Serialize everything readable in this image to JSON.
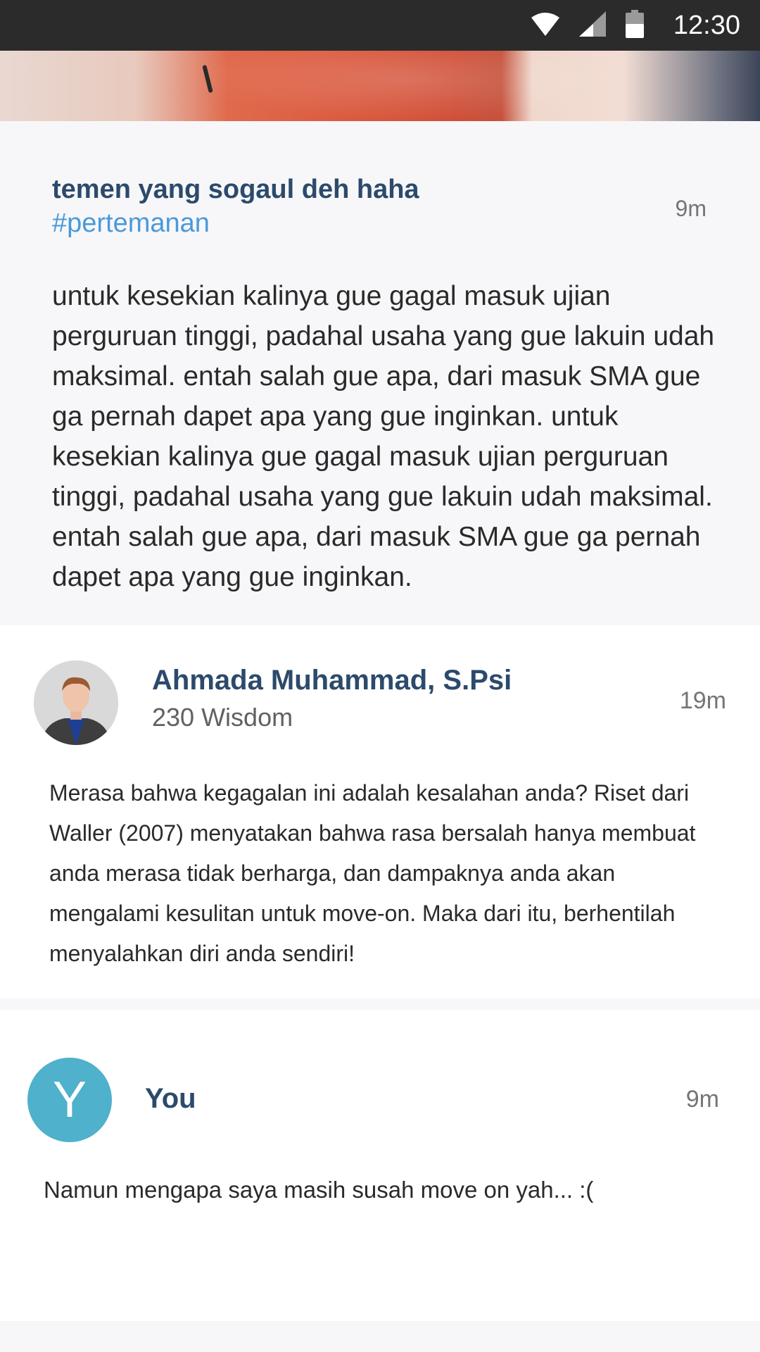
{
  "status_bar": {
    "time": "12:30",
    "icons": [
      "wifi-icon",
      "cell-signal-icon",
      "battery-icon"
    ]
  },
  "post": {
    "title": "temen yang sogaul deh haha",
    "hashtag": "#pertemanan",
    "time": "9m",
    "body": "untuk kesekian kalinya gue gagal masuk ujian perguruan tinggi, padahal usaha yang gue lakuin udah maksimal. entah salah gue apa, dari masuk SMA gue ga pernah dapet apa yang gue inginkan. untuk kesekian kalinya gue gagal masuk ujian perguruan tinggi, padahal usaha yang gue lakuin udah maksimal. entah salah gue apa, dari masuk SMA gue ga pernah dapet apa yang gue inginkan."
  },
  "replies": [
    {
      "name": "Ahmada Muhammad, S.Psi",
      "wisdom": "230 Wisdom",
      "time": "19m",
      "body": "Merasa bahwa kegagalan ini adalah kesalahan anda? Riset dari Waller (2007) menyatakan bahwa rasa bersalah hanya membuat anda merasa tidak berharga, dan dampaknya anda akan mengalami kesulitan untuk move-on. Maka dari itu, berhentilah menyalahkan diri anda sendiri!"
    },
    {
      "avatar_letter": "Y",
      "name": "You",
      "time": "9m",
      "body": "Namun mengapa saya masih susah move on yah... :("
    }
  ],
  "colors": {
    "status_bar": "#2b2b2b",
    "title": "#2c4a6b",
    "hashtag": "#4a9ad9",
    "avatar_you": "#4fb1cb",
    "post_background": "#f7f7f9"
  }
}
